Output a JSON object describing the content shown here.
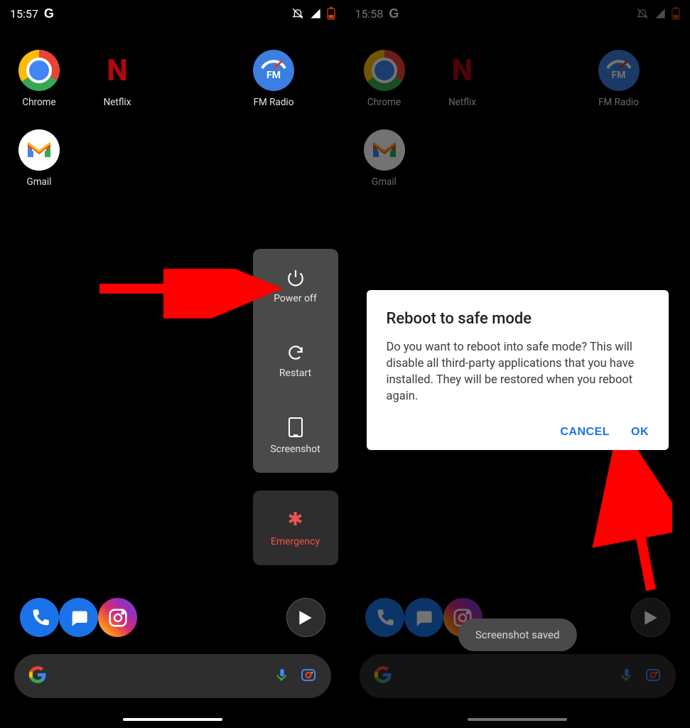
{
  "left": {
    "status": {
      "time": "15:57",
      "brand": "G"
    },
    "apps": [
      {
        "label": "Chrome"
      },
      {
        "label": "Netflix"
      },
      {
        "label": "FM Radio",
        "fm_text": "FM"
      },
      {
        "label": "Gmail"
      }
    ],
    "power_menu": {
      "items": [
        {
          "label": "Power off"
        },
        {
          "label": "Restart"
        },
        {
          "label": "Screenshot"
        }
      ],
      "emergency": "Emergency"
    }
  },
  "right": {
    "status": {
      "time": "15:58",
      "brand": "G"
    },
    "apps": [
      {
        "label": "Chrome"
      },
      {
        "label": "Netflix"
      },
      {
        "label": "FM Radio",
        "fm_text": "FM"
      },
      {
        "label": "Gmail"
      }
    ],
    "dialog": {
      "title": "Reboot to safe mode",
      "body": "Do you want to reboot into safe mode? This will disable all third-party applications that you have installed. They will be restored when you reboot again.",
      "cancel": "CANCEL",
      "ok": "OK"
    },
    "toast": "Screenshot saved"
  }
}
